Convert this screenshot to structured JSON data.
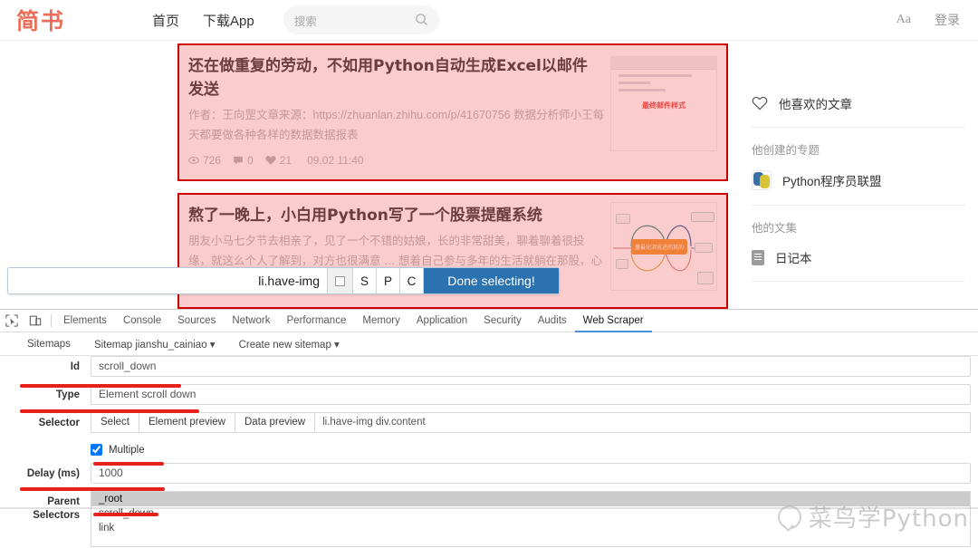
{
  "site": {
    "brand": "简书",
    "nav": [
      {
        "label": "首页",
        "name": "nav-home"
      },
      {
        "label": "下载App",
        "name": "nav-download-app"
      }
    ],
    "search_placeholder": "搜索",
    "search_value": "",
    "font_toggle": "Aa",
    "login": "登录"
  },
  "articles": [
    {
      "title": "还在做重复的劳动，不如用Python自动生成Excel以邮件发送",
      "abstract": "作者：王向罡文章来源：https://zhuanlan.zhihu.com/p/41670756 数据分析师小王每天都要做各种各样的数据数据报表",
      "views": "726",
      "comments": "0",
      "likes": "21",
      "date": "09.02 11:40",
      "thumb_caption": "最终邮件样式"
    },
    {
      "title": "熬了一晚上，小白用Python写了一个股票提醒系统",
      "abstract": "朋友小马七夕节去相亲了，见了一个不错的姑娘，长的非常甜美，聊着聊着很投缘，就这么个人了解到，对方也很满意 … 想着自己参与多年的生活就躺在那股，心",
      "thumb_caption": "量最化浏览进的其的"
    }
  ],
  "sidebar": {
    "liked_articles": "他喜欢的文章",
    "collections_head": "他创建的专题",
    "collection_item": "Python程序员联盟",
    "notebooks_head": "他的文集",
    "notebook_item": "日记本"
  },
  "selector_toolbar": {
    "selector_value": "li.have-img",
    "keys": [
      "S",
      "P",
      "C"
    ],
    "done_label": "Done selecting!"
  },
  "devtools": {
    "icons": [
      "inspect-icon",
      "device-toolbar-icon"
    ],
    "tabs": [
      "Elements",
      "Console",
      "Sources",
      "Network",
      "Performance",
      "Memory",
      "Application",
      "Security",
      "Audits",
      "Web Scraper"
    ],
    "active_tab": "Web Scraper",
    "subbar": [
      "Sitemaps",
      "Sitemap jianshu_cainiao ▾",
      "Create new sitemap ▾"
    ]
  },
  "form": {
    "id_label": "Id",
    "id_value": "scroll_down",
    "type_label": "Type",
    "type_value": "Element scroll down",
    "selector_label": "Selector",
    "selector_buttons": [
      "Select",
      "Element preview",
      "Data preview"
    ],
    "selector_value": "li.have-img div.content",
    "multiple_label": "Multiple",
    "multiple_checked": true,
    "delay_label": "Delay (ms)",
    "delay_value": "1000",
    "parent_label_line1": "Parent",
    "parent_label_line2": "Selectors",
    "parent_options": [
      "_root",
      "scroll_down",
      "link"
    ],
    "parent_selected": "_root"
  },
  "watermark": {
    "text": "菜鸟学Python"
  },
  "colors": {
    "brand": "#ea6f5a",
    "selection_border": "#cc0000",
    "selection_overlay": "rgba(237,85,85,0.30)",
    "primary_button": "#2a72b0",
    "marker_red": "#e8201a",
    "active_tab_underline": "#4a90d9"
  }
}
